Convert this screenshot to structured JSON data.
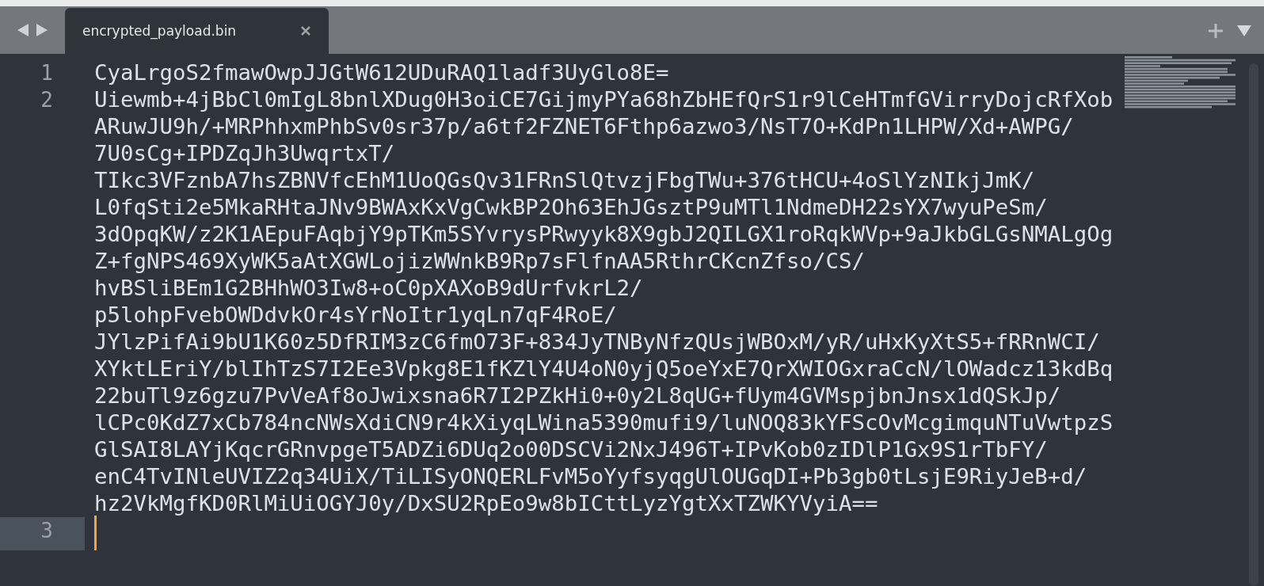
{
  "tabs": [
    {
      "label": "encrypted_payload.bin",
      "selected": true
    }
  ],
  "lines": [
    {
      "number": "1",
      "current": false,
      "rows": [
        "CyaLrgoS2fmawOwpJJGtW612UDuRAQ1ladf3UyGlo8E="
      ]
    },
    {
      "number": "2",
      "current": false,
      "rows": [
        "Uiewmb+4jBbCl0mIgL8bnlXDug0H3oiCE7GijmyPYa68hZbHEfQrS1r9lCeHTmfGVirryDojcRfXob",
        "ARuwJU9h/+MRPhhxmPhbSv0sr37p/a6tf2FZNET6Fthp6azwo3/NsT7O+KdPn1LHPW/Xd+AWPG/",
        "7U0sCg+IPDZqJh3UwqrtxT/",
        "TIkc3VFznbA7hsZBNVfcEhM1UoQGsQv31FRnSlQtvzjFbgTWu+376tHCU+4oSlYzNIkjJmK/",
        "L0fqSti2e5MkaRHtaJNv9BWAxKxVgCwkBP2Oh63EhJGsztP9uMTl1NdmeDH22sYX7wyuPeSm/",
        "3dOpqKW/z2K1AEpuFAqbjY9pTKm5SYvrysPRwyyk8X9gbJ2QILGX1roRqkWVp+9aJkbGLGsNMALgOg",
        "Z+fgNPS469XyWK5aAtXGWLojizWWnkB9Rp7sFlfnAA5RthrCKcnZfso/CS/",
        "hvBSliBEm1G2BHhWO3Iw8+oC0pXAXoB9dUrfvkrL2/",
        "p5lohpFvebOWDdvkOr4sYrNoItr1yqLn7qF4RoE/",
        "JYlzPifAi9bU1K60z5DfRIM3zC6fmO73F+834JyTNByNfzQUsjWBOxM/yR/uHxKyXtS5+fRRnWCI/",
        "XYktLEriY/blIhTzS7I2Ee3Vpkg8E1fKZlY4U4oN0yjQ5oeYxE7QrXWIOGxraCcN/lOWadcz13kdBq",
        "22buTl9z6gzu7PvVeAf8oJwixsna6R7I2PZkHi0+0y2L8qUG+fUym4GVMspjbnJnsx1dQSkJp/",
        "lCPc0KdZ7xCb784ncNWsXdiCN9r4kXiyqLWina5390mufi9/luNOQ83kYFScOvMcgimquNTuVwtpzS",
        "GlSAI8LAYjKqcrGRnvpgeT5ADZi6DUq2o00DSCVi2NxJ496T+IPvKob0zIDlP1Gx9S1rTbFY/",
        "enC4TvINleUVIZ2q34UiX/TiLISyONQERLFvM5oYyfsyqgUlOUGqDI+Pb3gb0tLsjE9RiyJeB+d/",
        "hz2VkMgfKD0RlMiUiOGYJ0y/DxSU2RpEo9w8bICttLyzYgtXxTZWKYVyiA=="
      ]
    },
    {
      "number": "3",
      "current": true
    }
  ]
}
